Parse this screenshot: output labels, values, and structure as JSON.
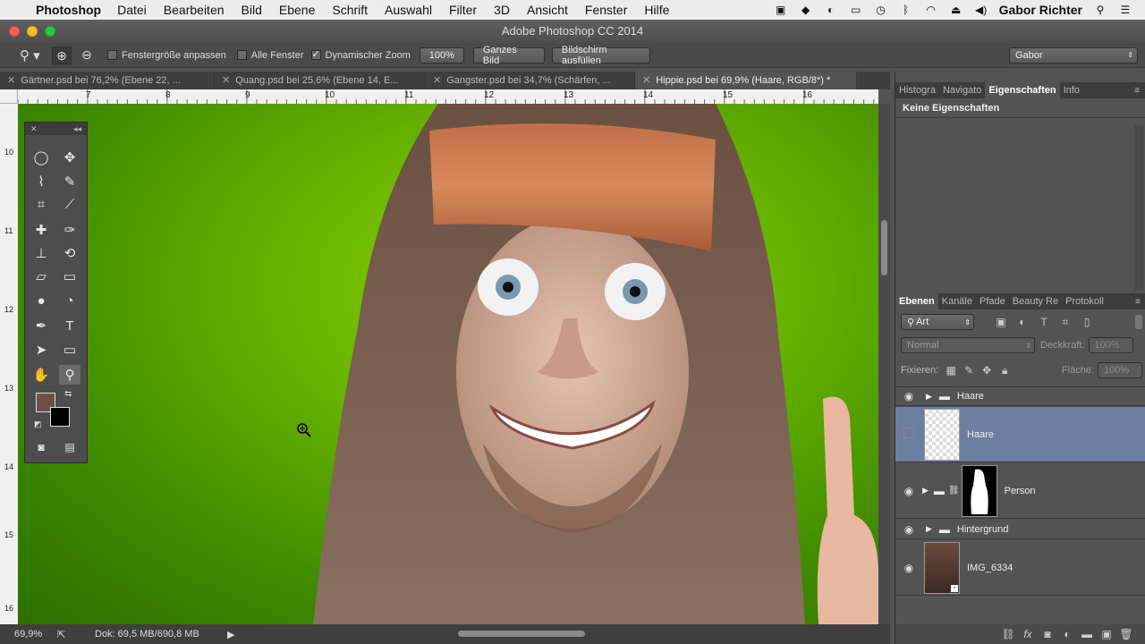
{
  "menubar": {
    "app": "Photoshop",
    "items": [
      "Datei",
      "Bearbeiten",
      "Bild",
      "Ebene",
      "Schrift",
      "Auswahl",
      "Filter",
      "3D",
      "Ansicht",
      "Fenster",
      "Hilfe"
    ],
    "user": "Gabor Richter"
  },
  "window": {
    "title": "Adobe Photoshop CC 2014"
  },
  "options": {
    "fit_window": "Fenstergröße anpassen",
    "all_windows": "Alle Fenster",
    "dynamic_zoom": "Dynamischer Zoom",
    "zoom_100": "100%",
    "whole_image": "Ganzes Bild",
    "fill_screen": "Bildschirm ausfüllen",
    "workspace": "Gabor"
  },
  "tabs": [
    "Gärtner.psd bei 76,2% (Ebene 22, ...",
    "Quang.psd bei 25,6% (Ebene 14, E...",
    "Gangster.psd bei 34,7% (Schärfen, ...",
    "Hippie.psd bei 69,9% (Haare, RGB/8*) *"
  ],
  "ruler_h": [
    "7",
    "8",
    "9",
    "10",
    "11",
    "12",
    "13",
    "14",
    "15",
    "16"
  ],
  "ruler_v": [
    "10",
    "11",
    "12",
    "13",
    "14",
    "15",
    "16"
  ],
  "status": {
    "zoom": "69,9%",
    "doc": "Dok: 69,5 MB/690,8 MB"
  },
  "properties": {
    "tabs": [
      "Histogra",
      "Navigato",
      "Eigenschaften",
      "Info"
    ],
    "content": "Keine Eigenschaften"
  },
  "layers_panel": {
    "tabs": [
      "Ebenen",
      "Kanäle",
      "Pfade",
      "Beauty Re",
      "Protokoll"
    ],
    "filter": "Art",
    "blend_mode": "Normal",
    "opacity_label": "Deckkraft:",
    "opacity_value": "100%",
    "lock_label": "Fixieren:",
    "fill_label": "Fläche:",
    "fill_value": "100%",
    "layers": [
      {
        "name": "Haare",
        "type": "group"
      },
      {
        "name": "Haare",
        "type": "layer",
        "selected": true
      },
      {
        "name": "Person",
        "type": "group-mask"
      },
      {
        "name": "Hintergrund",
        "type": "group"
      },
      {
        "name": "IMG_6334",
        "type": "smart-object"
      }
    ]
  },
  "colors": {
    "accent_selected": "#6c7fa1",
    "foreground": "#6b5149",
    "background": "#000000"
  }
}
